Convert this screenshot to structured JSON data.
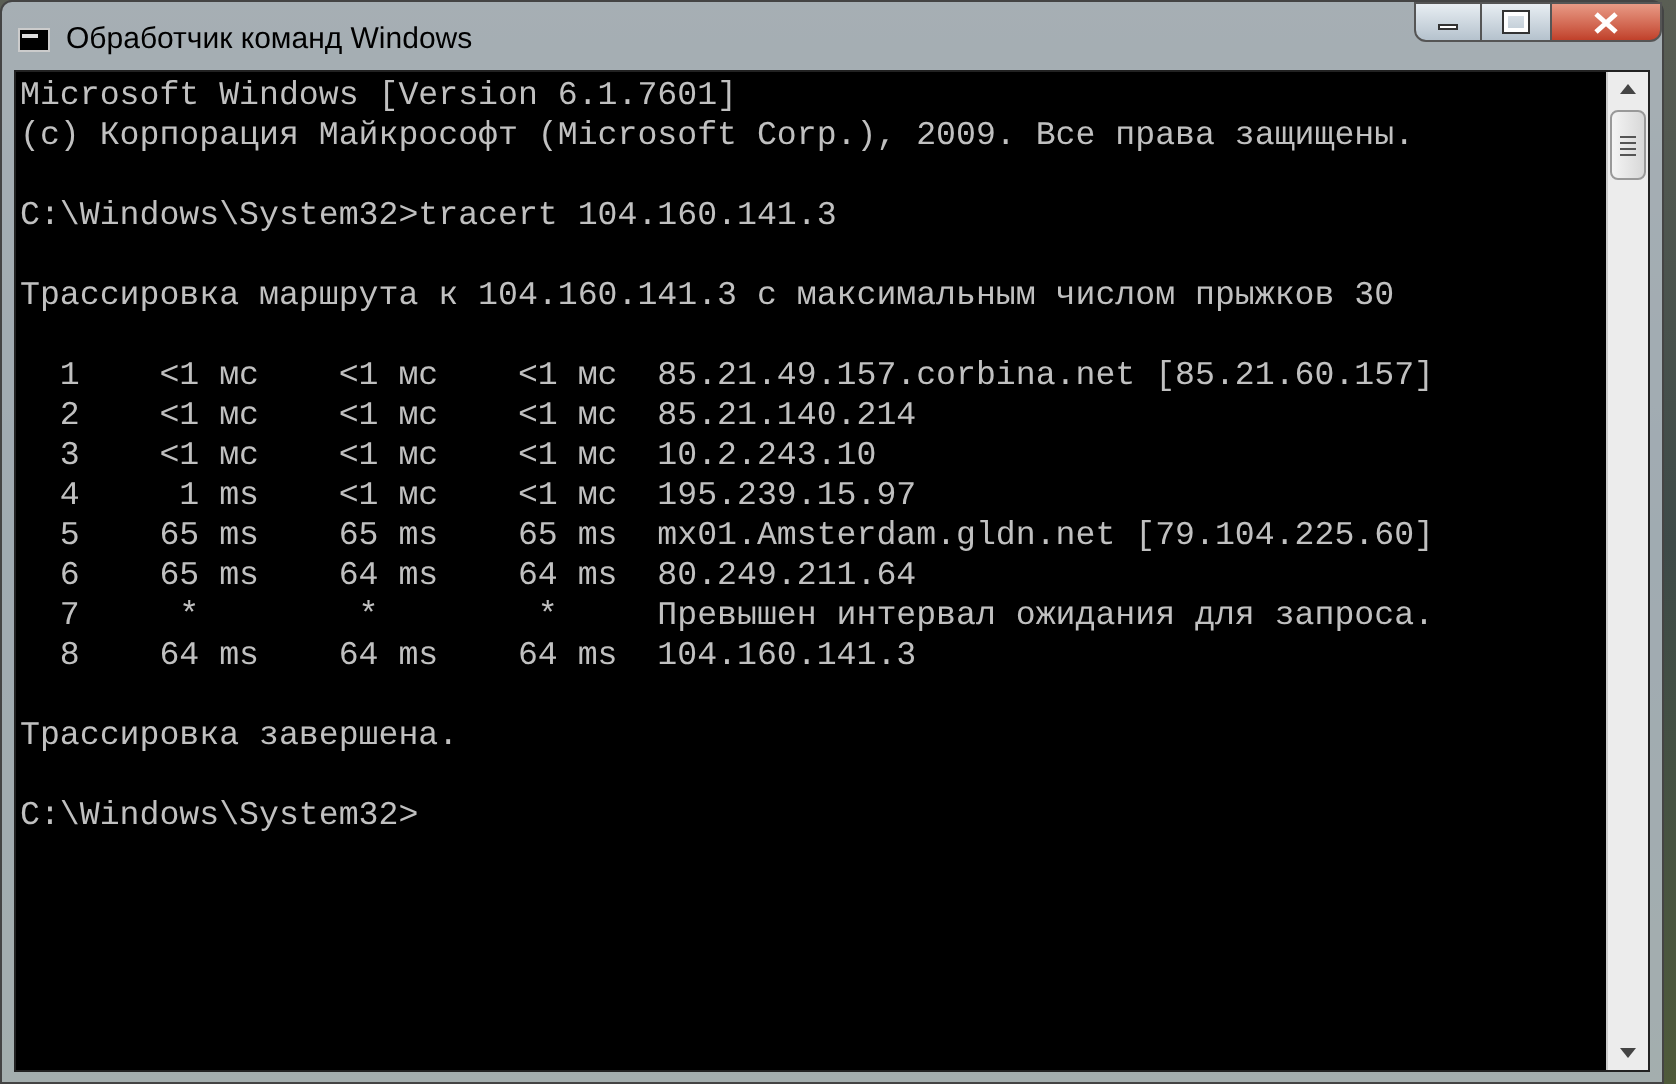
{
  "window": {
    "title": "Обработчик команд Windows"
  },
  "console": {
    "blocks": [
      [
        "Microsoft Windows [Version 6.1.7601]",
        "(c) Корпорация Майкрософт (Microsoft Corp.), 2009. Все права защищены."
      ],
      [
        "C:\\Windows\\System32>tracert 104.160.141.3"
      ],
      [
        "Трассировка маршрута к 104.160.141.3 с максимальным числом прыжков 30"
      ],
      [
        "  1    <1 мс    <1 мс    <1 мс  85.21.49.157.corbina.net [85.21.60.157]",
        "  2    <1 мс    <1 мс    <1 мс  85.21.140.214",
        "  3    <1 мс    <1 мс    <1 мс  10.2.243.10",
        "  4     1 ms    <1 мс    <1 мс  195.239.15.97",
        "  5    65 ms    65 ms    65 ms  mx01.Amsterdam.gldn.net [79.104.225.60]",
        "  6    65 ms    64 ms    64 ms  80.249.211.64",
        "  7     *        *        *     Превышен интервал ожидания для запроса.",
        "  8    64 ms    64 ms    64 ms  104.160.141.3"
      ],
      [
        "Трассировка завершена."
      ],
      [
        "C:\\Windows\\System32>"
      ]
    ]
  }
}
